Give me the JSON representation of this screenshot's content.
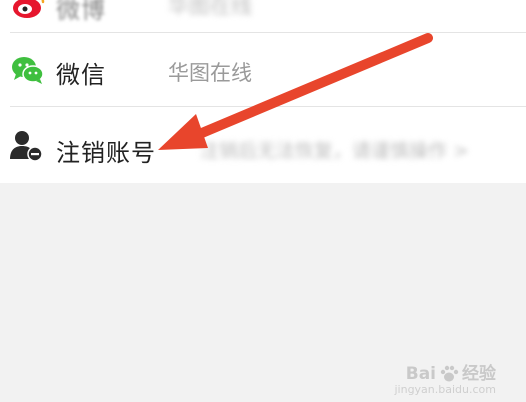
{
  "rows": {
    "weibo": {
      "label": "微博",
      "value": "华图在线"
    },
    "wechat": {
      "label": "微信",
      "value": "华图在线"
    },
    "cancel": {
      "label": "注销账号",
      "value": "注销后无法恢复，请谨慎操作 >"
    }
  },
  "icons": {
    "weibo": "weibo-icon",
    "wechat": "wechat-icon",
    "cancel": "user-remove-icon"
  },
  "colors": {
    "weibo": "#e6162d",
    "wechat": "#3fbf3f",
    "arrow": "#e8452c",
    "background": "#f2f2f2"
  },
  "watermark": {
    "brand_prefix": "Bai",
    "brand_suffix": "经验",
    "site": "jingyan.baidu.com"
  }
}
